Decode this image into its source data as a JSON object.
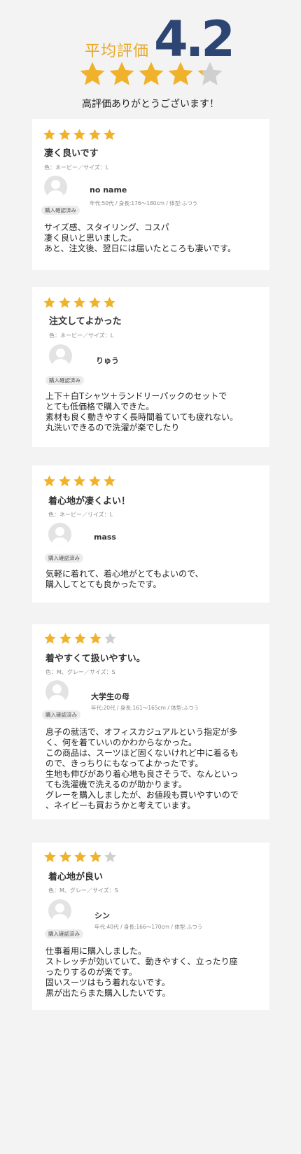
{
  "summary": {
    "label": "平均評価",
    "average": "4.2",
    "rating": 4.2,
    "thanks": "高評価ありがとうございます！"
  },
  "colors": {
    "star_filled": "#f0b22a",
    "star_empty": "#cfcfcf",
    "average_number": "#2d4573",
    "average_label": "#e8a82a"
  },
  "reviews": [
    {
      "rating": 5,
      "title": "凄く良いです",
      "variant": "色：ネービー／サイズ：L",
      "name": "no name",
      "profile": "年代:50代 / 身長:176〜180cm / 体型:ふつう",
      "badge": "購入確認済み",
      "body": [
        "サイズ感、スタイリング、コスパ",
        "凄く良いと思いました。",
        "あと、注文後、翌日には届いたところも凄いです。"
      ]
    },
    {
      "rating": 5,
      "title": "注文してよかった",
      "variant": "色：ネービー／サイズ：L",
      "name": "りゅう",
      "profile": "",
      "badge": "購入確認済み",
      "body": [
        "上下＋白Tシャツ＋ランドリーパックのセットで",
        "とても低価格で購入できた。",
        "素材も良く動きやすく長時間着ていても疲れない。",
        "丸洗いできるので洗濯が楽でしたり"
      ]
    },
    {
      "rating": 5,
      "title": "着心地が凄くよい！",
      "variant": "色：ネービー／リイズ：L",
      "name": "mass",
      "profile": "",
      "badge": "購入確認済み",
      "body": [
        "気軽に着れて、着心地がとてもよいので、",
        "購入してとても良かったです。"
      ]
    },
    {
      "rating": 4,
      "title": "着やすくて扱いやすい。",
      "variant": "色：M、グレー／サイズ：S",
      "name": "大学生の母",
      "profile": "年代:20代 / 身長:161〜165cm / 体型:ふつう",
      "badge": "購入確認済み",
      "body": [
        "息子の就活で、オフィスカジュアルという指定が多",
        "く、何を着ていいのかわからなかった。",
        "この商品は、スーツほど固くないけれど中に着るも",
        "ので、きっちりにもなってよかったです。",
        "生地も伸びがあり着心地も良さそうで、なんといっ",
        "ても洗濯機で洗えるのが助かります。",
        "グレーを購入しましたが、お値段も買いやすいので",
        "、ネイビーも買おうかと考えています。"
      ]
    },
    {
      "rating": 4,
      "title": "着心地が良い",
      "variant": "色：M、グレー／サイズ：S",
      "name": "シン",
      "profile": "年代:40代 / 身長:166〜170cm / 体型:ふつう",
      "badge": "購入確認済み",
      "body": [
        "仕事着用に購入しました。",
        "ストレッチが効いていて、動きやすく、立ったり座",
        "ったりするのが楽です。",
        "固いスーツはもう着れないです。",
        "黒が出たらまた購入したいです。"
      ]
    }
  ]
}
